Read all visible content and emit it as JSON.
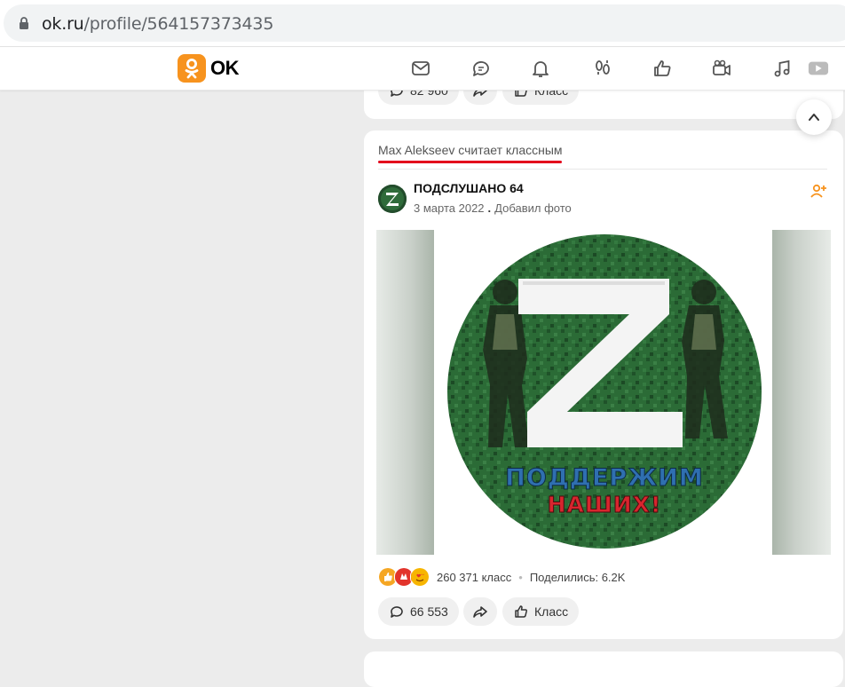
{
  "browser": {
    "url_host": "ok.ru",
    "url_path": "/profile/564157373435"
  },
  "header": {
    "logo_text": "OK",
    "nav_icons": [
      "messages-icon",
      "discussions-icon",
      "notifications-icon",
      "guests-icon",
      "events-icon",
      "video-icon",
      "music-icon",
      "games-icon"
    ]
  },
  "prev_post": {
    "comments_count": "82 960",
    "klass_label": "Класс"
  },
  "post": {
    "liked_by": "Max Alekseev считает классным",
    "group_name": "ПОДСЛУШАНО 64",
    "date": "3 марта 2022",
    "action": "Добавил фото",
    "image_text_line1": "ПОДДЕРЖИМ",
    "image_text_line2": "НАШИХ!",
    "reactions_count": "260 371 класс",
    "shared_label": "Поделились: 6.2K",
    "comments_count": "66 553",
    "klass_label": "Класс"
  },
  "colors": {
    "brand": "#f7931e",
    "underline": "#e3001b",
    "page_bg": "#ececec"
  }
}
